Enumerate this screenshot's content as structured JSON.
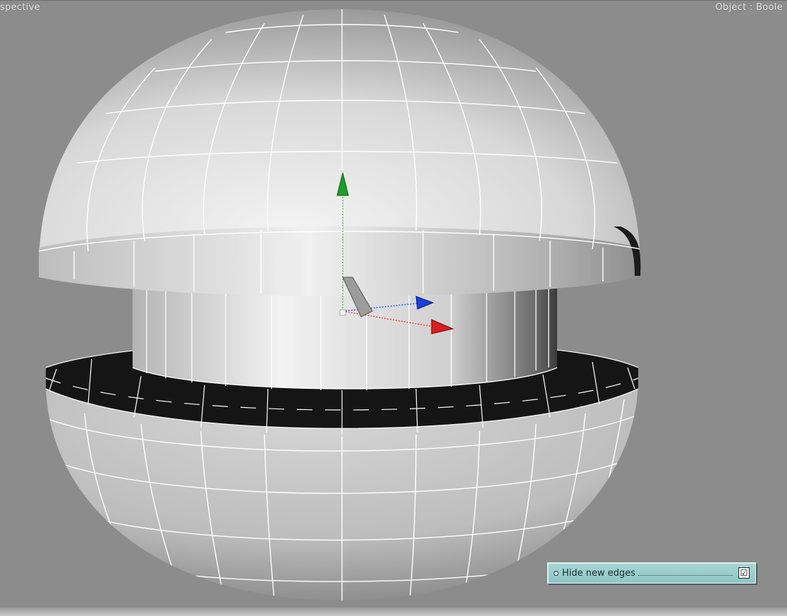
{
  "viewport": {
    "label_left": "spective",
    "label_right": "Object : Boole"
  },
  "option_panel": {
    "label": "Hide new edges",
    "checked": true,
    "check_glyph": "☑"
  },
  "colors": {
    "viewport_bg": "#8c8c8c",
    "axis_y": "#1aa02a",
    "axis_x": "#d42020",
    "axis_z": "#1a3fd6",
    "panel_bg": "#9fd1cf"
  }
}
